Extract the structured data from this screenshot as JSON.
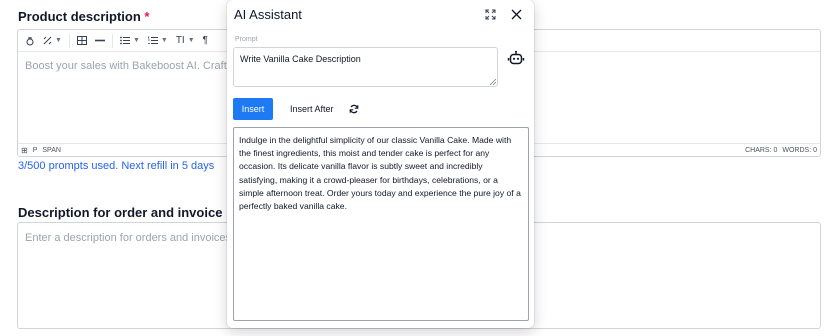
{
  "product_description": {
    "label": "Product description",
    "required_mark": "*",
    "toolbar": {
      "format_label": "TI",
      "paragraph_label": "¶"
    },
    "placeholder": "Boost your sales with Bakeboost AI. Craft irres",
    "status": {
      "path": [
        "P",
        "SPAN"
      ],
      "chars": "CHARS: 0",
      "words": "WORDS: 0"
    },
    "prompts_note": "3/500 prompts used. Next refill in 5 days"
  },
  "order_description": {
    "label": "Description for order and invoice",
    "placeholder": "Enter a description for orders and invoices"
  },
  "ai_assistant": {
    "title": "AI Assistant",
    "prompt_label": "Prompt",
    "prompt_value": "Write Vanilla Cake Description",
    "insert_label": "Insert",
    "insert_after_label": "Insert After",
    "result_text": "Indulge in the delightful simplicity of our classic Vanilla Cake. Made with the finest ingredients, this moist and tender cake is perfect for any occasion. Its delicate vanilla flavor is subtly sweet and incredibly satisfying, making it a crowd-pleaser for birthdays, celebrations, or a simple afternoon treat. Order yours today and experience the pure joy of a perfectly baked vanilla cake."
  },
  "colors": {
    "accent": "#1d7af3",
    "link": "#2563eb",
    "required": "#e11d48"
  },
  "icons": [
    "magic-icon",
    "text-style-icon",
    "table-icon",
    "horizontal-rule-icon",
    "bulleted-list-icon",
    "numbered-list-icon",
    "font-size-icon",
    "paragraph-icon",
    "expand-icon",
    "close-icon",
    "robot-icon",
    "refresh-icon"
  ]
}
